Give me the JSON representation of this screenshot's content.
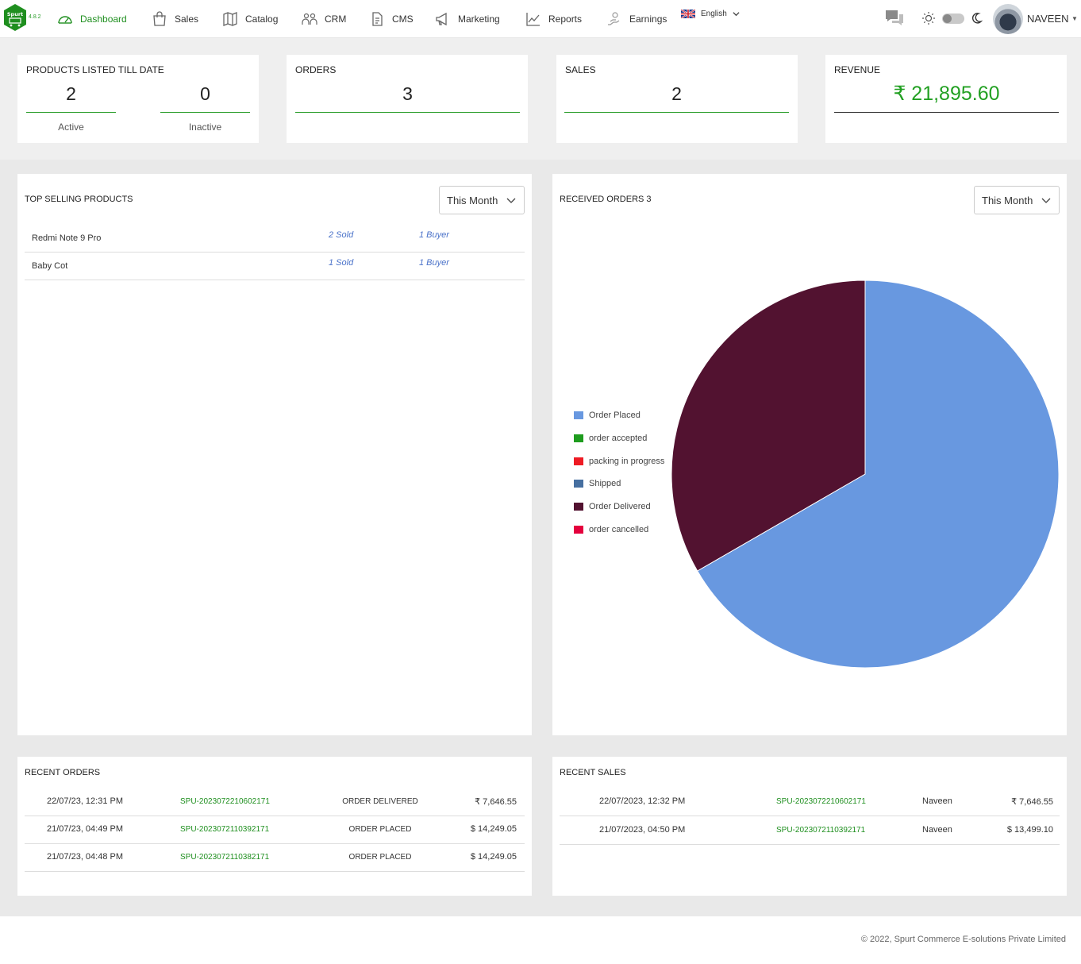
{
  "app": {
    "logo_text": "Spurt",
    "version": "4.8.2"
  },
  "nav": {
    "items": [
      {
        "label": "Dashboard",
        "icon": "gauge-icon",
        "active": true
      },
      {
        "label": "Sales",
        "icon": "shopping-bag-icon"
      },
      {
        "label": "Catalog",
        "icon": "map-book-icon"
      },
      {
        "label": "CRM",
        "icon": "users-icon"
      },
      {
        "label": "CMS",
        "icon": "document-icon"
      },
      {
        "label": "Marketing",
        "icon": "megaphone-icon"
      },
      {
        "label": "Reports",
        "icon": "line-chart-icon"
      },
      {
        "label": "Earnings",
        "icon": "money-hand-icon"
      }
    ],
    "language": "English",
    "user": "NAVEEN"
  },
  "stats": {
    "products": {
      "title": "PRODUCTS LISTED TILL DATE",
      "active": "2",
      "active_label": "Active",
      "inactive": "0",
      "inactive_label": "Inactive"
    },
    "orders": {
      "title": "ORDERS",
      "value": "3"
    },
    "sales": {
      "title": "SALES",
      "value": "2"
    },
    "revenue": {
      "title": "REVENUE",
      "value": "₹ 21,895.60"
    }
  },
  "top_selling": {
    "title": "TOP SELLING PRODUCTS",
    "period": "This Month",
    "rows": [
      {
        "name": "Redmi Note 9 Pro",
        "sold": "2 Sold",
        "buyers": "1 Buyer"
      },
      {
        "name": "Baby Cot",
        "sold": "1 Sold",
        "buyers": "1 Buyer"
      }
    ]
  },
  "received_orders": {
    "title": "RECEIVED ORDERS 3",
    "period": "This Month"
  },
  "chart_data": {
    "type": "pie",
    "categories": [
      "Order Placed",
      "order accepted",
      "packing in progress",
      "Shipped",
      "Order Delivered",
      "order cancelled"
    ],
    "values": [
      2,
      0,
      0,
      0,
      1,
      0
    ],
    "colors": [
      "#6898e0",
      "#1e9c1e",
      "#ee1b24",
      "#466fa0",
      "#521230",
      "#e4003d"
    ],
    "legend": "left"
  },
  "recent_orders": {
    "title": "RECENT ORDERS",
    "rows": [
      {
        "date": "22/07/23, 12:31 PM",
        "id": "SPU-2023072210602171",
        "status": "ORDER DELIVERED",
        "amount": "₹ 7,646.55"
      },
      {
        "date": "21/07/23, 04:49 PM",
        "id": "SPU-2023072110392171",
        "status": "ORDER PLACED",
        "amount": "$ 14,249.05"
      },
      {
        "date": "21/07/23, 04:48 PM",
        "id": "SPU-2023072110382171",
        "status": "ORDER PLACED",
        "amount": "$ 14,249.05"
      }
    ]
  },
  "recent_sales": {
    "title": "RECENT SALES",
    "rows": [
      {
        "date": "22/07/2023, 12:32 PM",
        "id": "SPU-2023072210602171",
        "customer": "Naveen",
        "amount": "₹ 7,646.55"
      },
      {
        "date": "21/07/2023, 04:50 PM",
        "id": "SPU-2023072110392171",
        "customer": "Naveen",
        "amount": "$ 13,499.10"
      }
    ]
  },
  "footer": "© 2022, Spurt Commerce E-solutions Private Limited"
}
